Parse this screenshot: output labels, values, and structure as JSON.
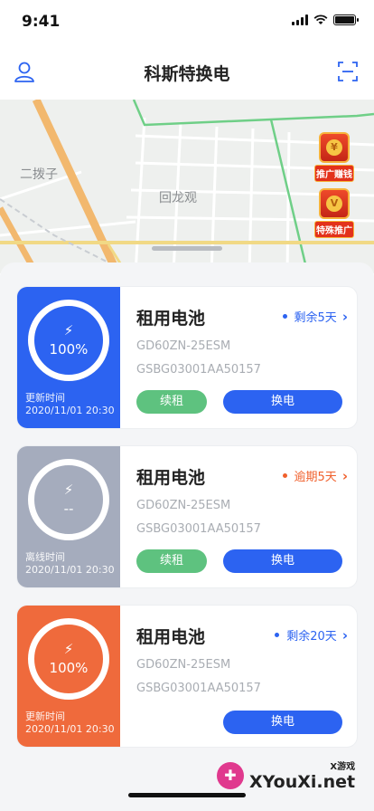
{
  "status_bar": {
    "time": "9:41"
  },
  "header": {
    "title": "科斯特换电",
    "user_icon": "user-icon",
    "scan_icon": "scan-icon"
  },
  "map": {
    "labels": [
      "二拨子",
      "回龙观"
    ],
    "promos": [
      {
        "tag": "推广赚钱",
        "icon": "coin-icon",
        "coin": "¥"
      },
      {
        "tag": "特殊推广",
        "icon": "special-user-icon",
        "coin": "V"
      }
    ]
  },
  "cards": [
    {
      "title": "租用电池",
      "status_text": "剩余5天",
      "status_color": "#2c63f1",
      "model": "GD60ZN-25ESM",
      "serial": "GSBG03001AA50157",
      "side_color": "#2c63f1",
      "bolt": "⚡",
      "percent": "100%",
      "time_label": "更新时间",
      "time": "2020/11/01 20:30",
      "renew_label": "续租",
      "swap_label": "换电"
    },
    {
      "title": "租用电池",
      "status_text": "逾期5天",
      "status_color": "#f0602c",
      "model": "GD60ZN-25ESM",
      "serial": "GSBG03001AA50157",
      "side_color": "#a5acbd",
      "bolt": "⚡",
      "percent": "--",
      "time_label": "离线时间",
      "time": "2020/11/01 20:30",
      "renew_label": "续租",
      "swap_label": "换电"
    },
    {
      "title": "租用电池",
      "status_text": "剩余20天",
      "status_color": "#2c63f1",
      "model": "GD60ZN-25ESM",
      "serial": "GSBG03001AA50157",
      "side_color": "#ef6a3c",
      "bolt": "⚡",
      "percent": "100%",
      "time_label": "更新时间",
      "time": "2020/11/01 20:30",
      "swap_label": "换电"
    }
  ],
  "watermark": {
    "text": "XYouXi.net",
    "small": "X游戏"
  }
}
